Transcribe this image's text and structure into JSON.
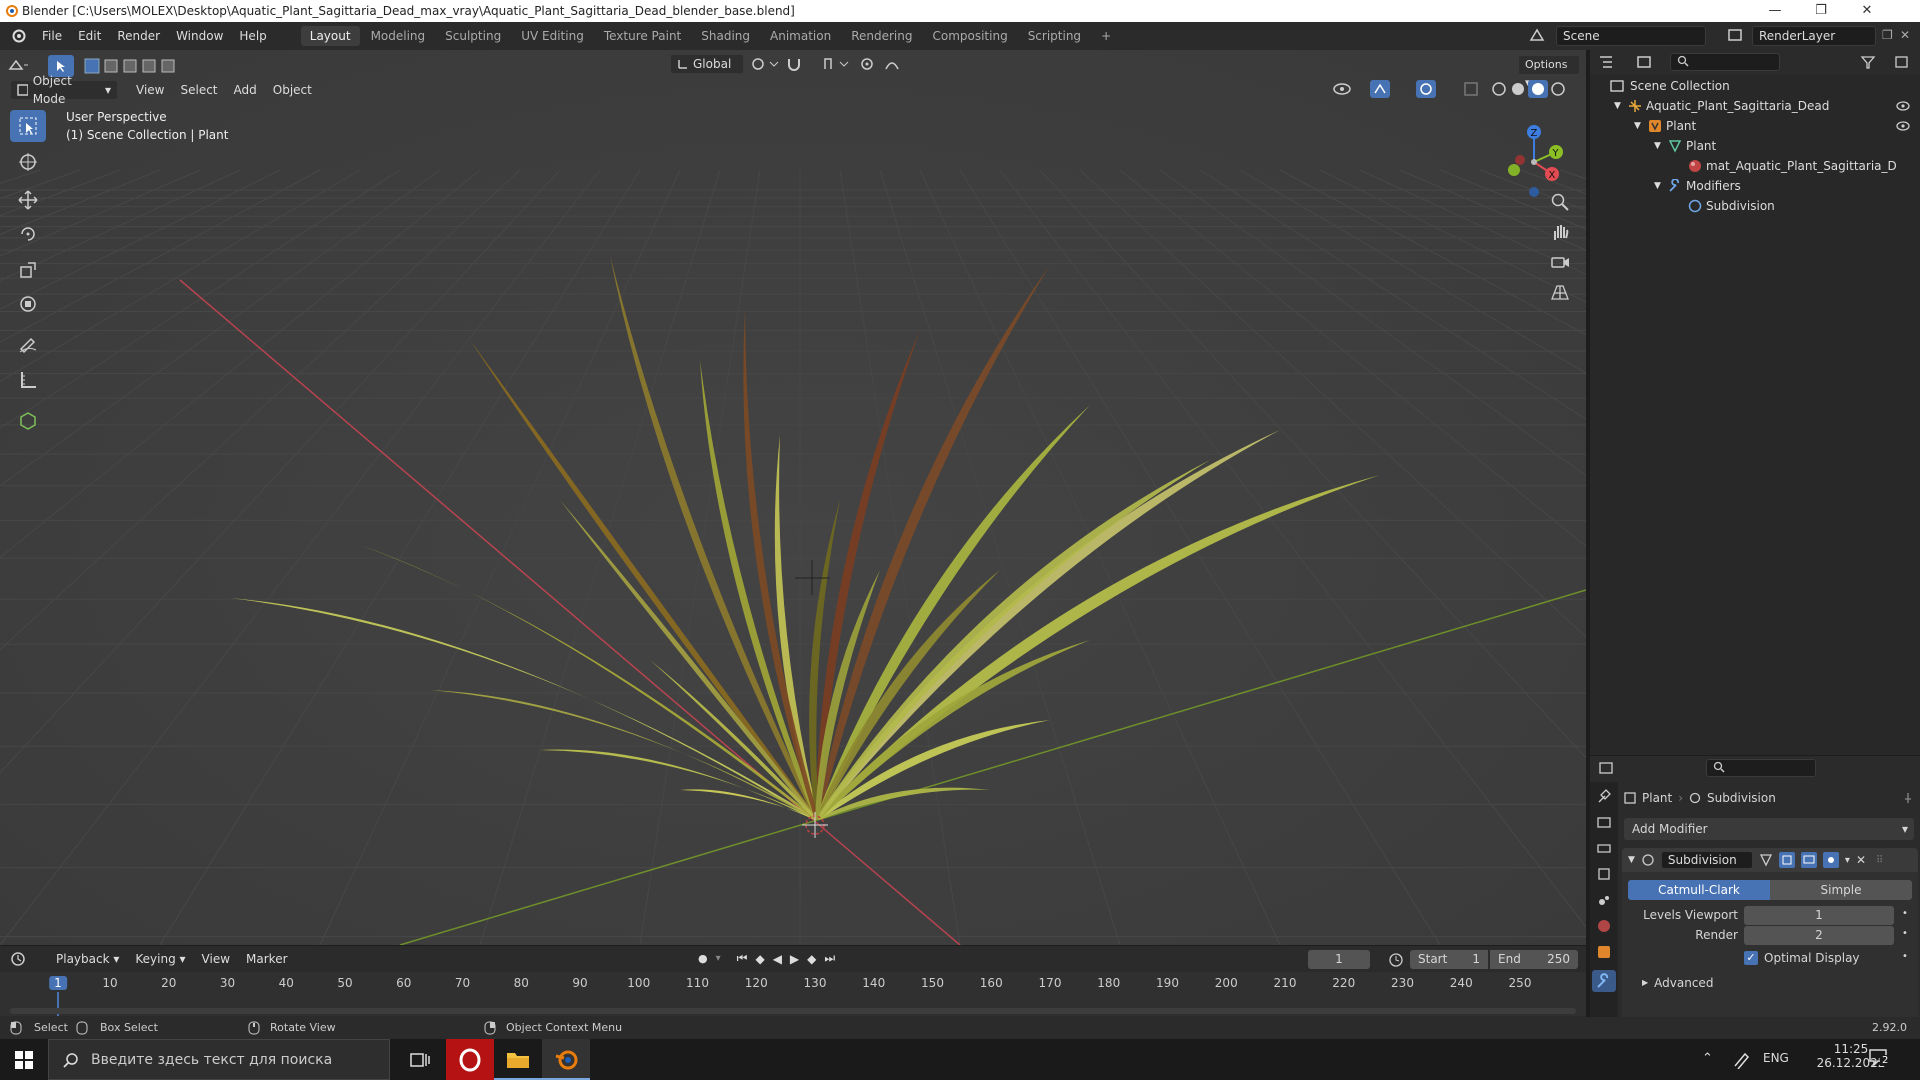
{
  "window": {
    "title": "Blender [C:\\Users\\MOLEX\\Desktop\\Aquatic_Plant_Sagittaria_Dead_max_vray\\Aquatic_Plant_Sagittaria_Dead_blender_base.blend]"
  },
  "menu": [
    "File",
    "Edit",
    "Render",
    "Window",
    "Help"
  ],
  "workspaces": [
    "Layout",
    "Modeling",
    "Sculpting",
    "UV Editing",
    "Texture Paint",
    "Shading",
    "Animation",
    "Rendering",
    "Compositing",
    "Scripting"
  ],
  "active_workspace": "Layout",
  "scene": {
    "name": "Scene",
    "render_layer": "RenderLayer"
  },
  "viewport_header": {
    "mode": "Object Mode",
    "menus": [
      "View",
      "Select",
      "Add",
      "Object"
    ],
    "transform_orientation": "Global",
    "options": "Options"
  },
  "viewport": {
    "perspective": "User Perspective",
    "collection_info": "(1) Scene Collection | Plant",
    "gizmo": {
      "x": "X",
      "y": "Y",
      "z": "Z"
    }
  },
  "outliner": {
    "root": "Scene Collection",
    "items": [
      {
        "label": "Aquatic_Plant_Sagittaria_Dead",
        "icon": "empty-icon"
      },
      {
        "label": "Plant",
        "icon": "object-icon"
      },
      {
        "label": "Plant",
        "icon": "mesh-icon"
      },
      {
        "label": "mat_Aquatic_Plant_Sagittaria_D",
        "icon": "material-icon"
      },
      {
        "label": "Modifiers",
        "icon": "wrench-icon"
      },
      {
        "label": "Subdivision",
        "icon": "subdivision-icon"
      }
    ]
  },
  "properties": {
    "breadcrumb_object": "Plant",
    "breadcrumb_modifier": "Subdivision",
    "add_modifier": "Add Modifier",
    "modifier_name": "Subdivision",
    "type_catmull": "Catmull-Clark",
    "type_simple": "Simple",
    "levels_viewport_label": "Levels Viewport",
    "levels_viewport_value": "1",
    "render_label": "Render",
    "render_value": "2",
    "optimal_display": "Optimal Display",
    "advanced": "Advanced"
  },
  "timeline": {
    "menus": [
      "Playback",
      "Keying",
      "View",
      "Marker"
    ],
    "current_frame": "1",
    "start_label": "Start",
    "start_value": "1",
    "end_label": "End",
    "end_value": "250",
    "ruler": [
      "1",
      "10",
      "20",
      "30",
      "40",
      "50",
      "60",
      "70",
      "80",
      "90",
      "100",
      "110",
      "120",
      "130",
      "140",
      "150",
      "160",
      "170",
      "180",
      "190",
      "200",
      "210",
      "220",
      "230",
      "240",
      "250"
    ]
  },
  "status_bar": {
    "select": "Select",
    "box_select": "Box Select",
    "rotate_view": "Rotate View",
    "context_menu": "Object Context Menu",
    "version": "2.92.0"
  },
  "taskbar": {
    "search_placeholder": "Введите здесь текст для поиска",
    "language": "ENG",
    "time": "11:25",
    "date": "26.12.2022",
    "notifications": "2"
  },
  "colors": {
    "accent": "#4772b3",
    "x_axis": "#e34b52",
    "y_axis": "#8cbf26",
    "z_axis": "#3d7de0"
  }
}
